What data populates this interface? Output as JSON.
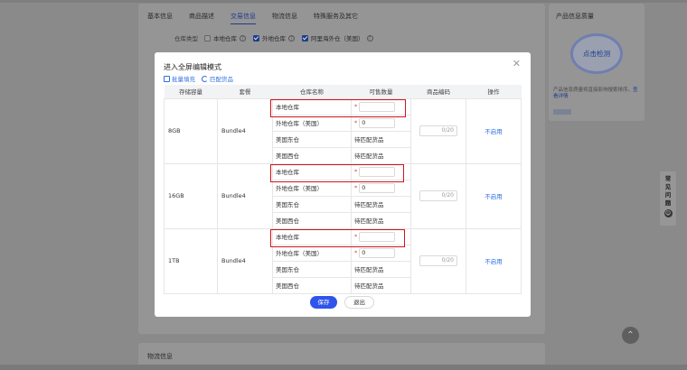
{
  "background": {
    "tabs": [
      {
        "label": "基本信息",
        "active": false
      },
      {
        "label": "商品描述",
        "active": false
      },
      {
        "label": "交易信息",
        "active": true
      },
      {
        "label": "物流信息",
        "active": false
      },
      {
        "label": "特殊服务及其它",
        "active": false
      }
    ],
    "warehouse_type_label": "仓库类型",
    "warehouse_options": [
      {
        "label": "本地仓库",
        "checked": false
      },
      {
        "label": "外地仓库",
        "checked": true
      },
      {
        "label": "阿里海外仓（美国）",
        "checked": true
      }
    ],
    "logistics_section": "物流信息",
    "side_panel": {
      "title": "产品信息质量",
      "detect_button": "点击检测",
      "desc": "产品信息质量将直接影响搜索排序，",
      "desc_link": "查看详情"
    },
    "faq_label": [
      "常",
      "见",
      "问",
      "题"
    ]
  },
  "modal": {
    "title": "进入全屏编辑模式",
    "close_glyph": "✕",
    "actions": {
      "bulk_fill": "批量填充",
      "match": "匹配货品"
    },
    "columns": [
      "存储容量",
      "套餐",
      "仓库名称",
      "可售数量",
      "商品编码",
      "操作"
    ],
    "groups": [
      {
        "capacity": "8GB",
        "package": "Bundle4",
        "code_counter": "0/20",
        "op": "不启用",
        "rows": [
          {
            "warehouse": "本地仓库",
            "qty_type": "input",
            "qty_value": ""
          },
          {
            "warehouse": "外地仓库（美国）",
            "qty_type": "input",
            "qty_value": "0"
          },
          {
            "warehouse": "美国东仓",
            "qty_type": "text",
            "qty_value": "待匹配货品"
          },
          {
            "warehouse": "美国西仓",
            "qty_type": "text",
            "qty_value": "待匹配货品"
          }
        ]
      },
      {
        "capacity": "16GB",
        "package": "Bundle4",
        "code_counter": "0/20",
        "op": "不启用",
        "rows": [
          {
            "warehouse": "本地仓库",
            "qty_type": "input",
            "qty_value": ""
          },
          {
            "warehouse": "外地仓库（美国）",
            "qty_type": "input",
            "qty_value": "0"
          },
          {
            "warehouse": "美国东仓",
            "qty_type": "text",
            "qty_value": "待匹配货品"
          },
          {
            "warehouse": "美国西仓",
            "qty_type": "text",
            "qty_value": "待匹配货品"
          }
        ]
      },
      {
        "capacity": "1TB",
        "package": "Bundle4",
        "code_counter": "0/20",
        "op": "不启用",
        "rows": [
          {
            "warehouse": "本地仓库",
            "qty_type": "input",
            "qty_value": ""
          },
          {
            "warehouse": "外地仓库（美国）",
            "qty_type": "input",
            "qty_value": "0"
          },
          {
            "warehouse": "美国东仓",
            "qty_type": "text",
            "qty_value": "待匹配货品"
          },
          {
            "warehouse": "美国西仓",
            "qty_type": "text",
            "qty_value": "待匹配货品"
          }
        ]
      }
    ],
    "save_label": "保存",
    "exit_label": "退出"
  },
  "colors": {
    "accent": "#2f54eb",
    "link": "#2f6fe0",
    "highlight_box": "#d0141b",
    "required": "#e23a3a"
  }
}
